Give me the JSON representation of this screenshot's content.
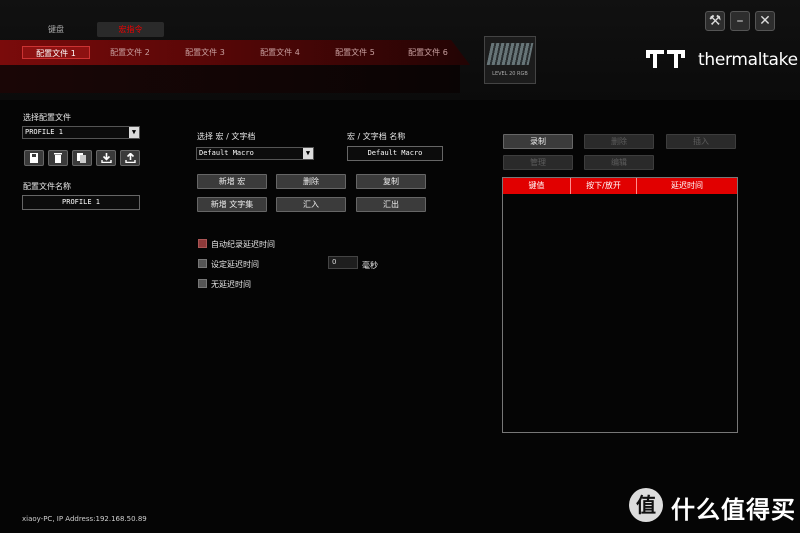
{
  "mode_tabs": {
    "keyboard": "键盘",
    "macro": "宏指令"
  },
  "profile_tabs": [
    "配置文件 1",
    "配置文件 2",
    "配置文件 3",
    "配置文件 4",
    "配置文件 5",
    "配置文件 6"
  ],
  "device": {
    "label": "LEVEL 20 RGB"
  },
  "brand": {
    "name": "thermaltake"
  },
  "left": {
    "select_profile_label": "选择配置文件",
    "profile_value": "PROFILE 1",
    "profile_name_label": "配置文件名称",
    "profile_name_value": "PROFILE 1"
  },
  "macro": {
    "select_label": "选择 宏 / 文字档",
    "select_value": "Default Macro",
    "name_label": "宏 / 文字档 名称",
    "name_value": "Default Macro",
    "buttons": {
      "new_macro": "新增 宏",
      "delete": "删除",
      "copy": "复制",
      "new_text": "新增 文字集",
      "import": "汇入",
      "export": "汇出"
    },
    "options": {
      "auto_record": "自动纪录延迟时间",
      "set_delay": "设定延迟时间",
      "no_delay": "无延迟时间"
    },
    "delay_value": "0",
    "delay_unit": "毫秒"
  },
  "record": {
    "buttons": {
      "record": "录制",
      "delete": "删除",
      "insert": "插入",
      "manage": "管理",
      "edit": "编辑"
    },
    "columns": [
      "键值",
      "按下/放开",
      "延迟时间"
    ]
  },
  "footer": {
    "status": "xiaoy-PC, IP Address:192.168.50.89"
  },
  "watermark": {
    "text": "什么值得买"
  },
  "colors": {
    "accent": "#e10000",
    "profile_bar": "#7a0b0b"
  }
}
